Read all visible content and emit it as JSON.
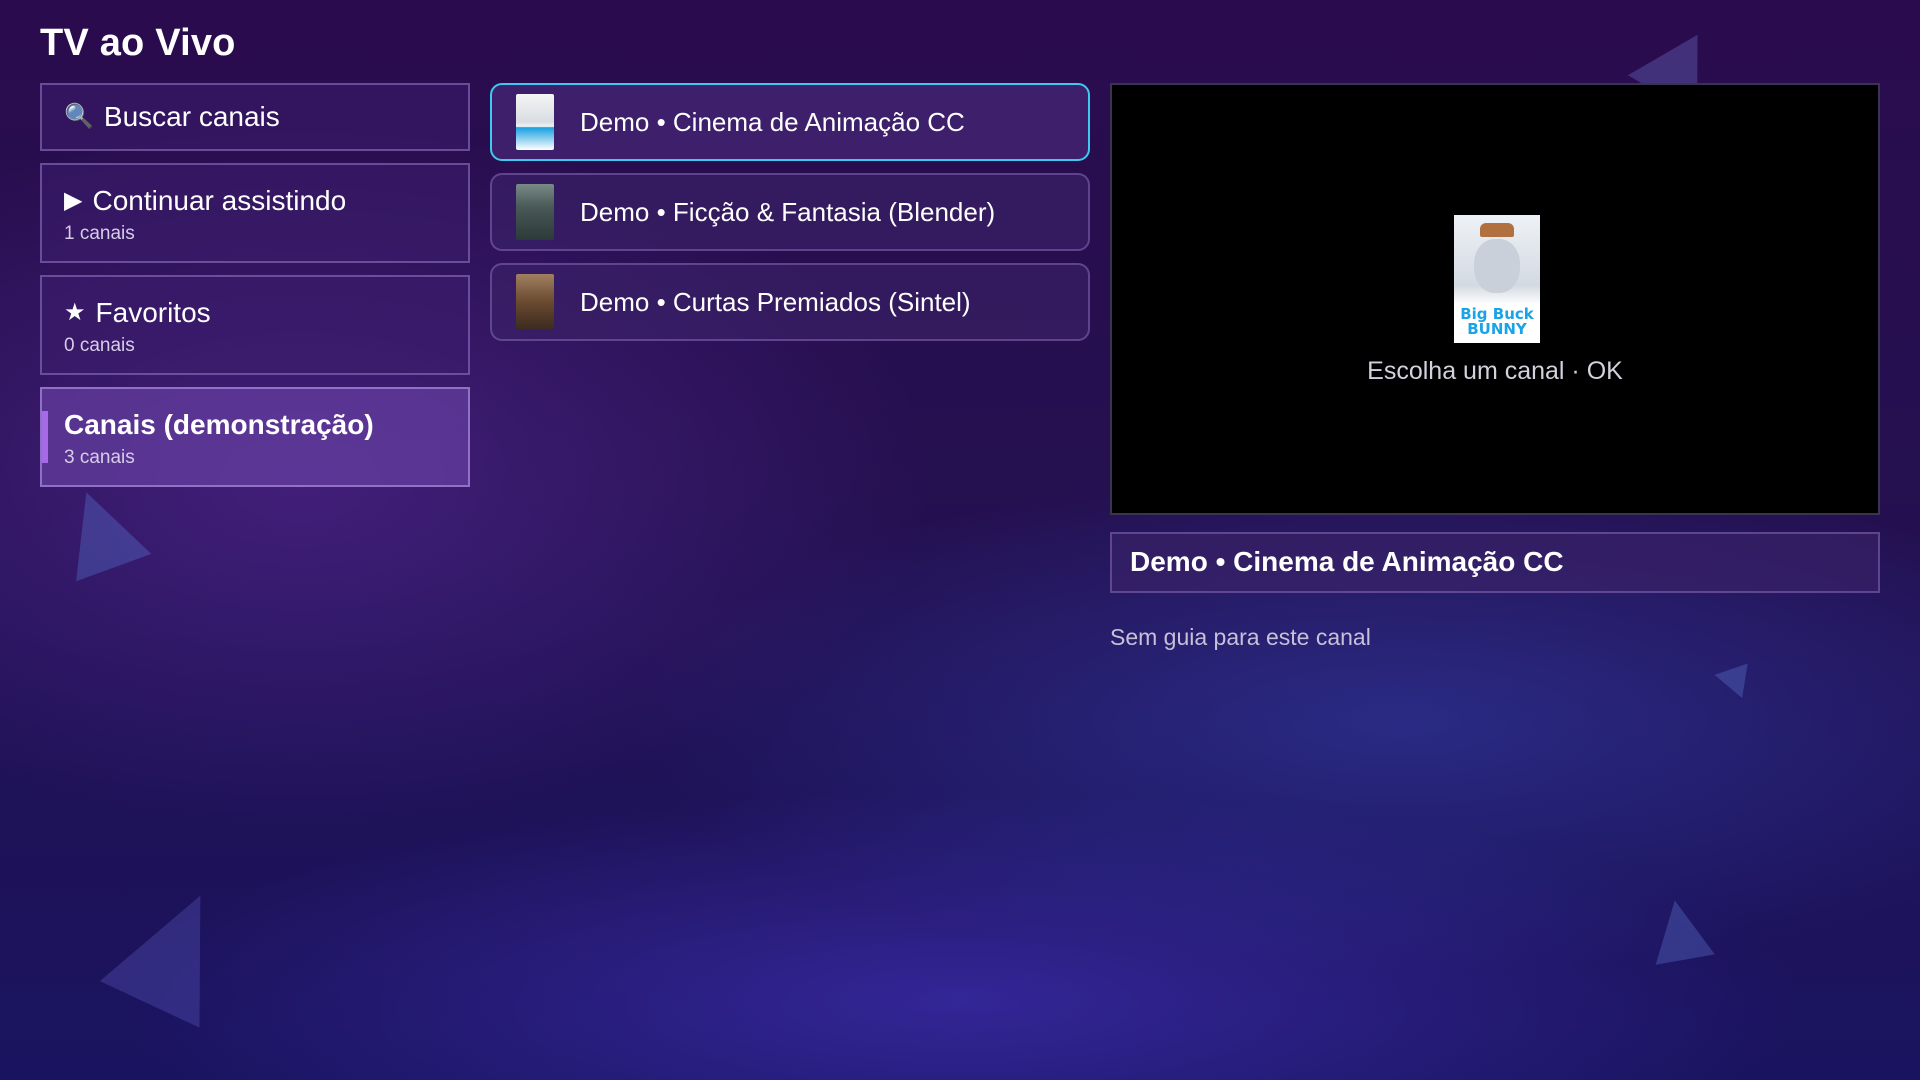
{
  "page": {
    "title": "TV ao Vivo"
  },
  "menu": {
    "search_label": "Buscar canais",
    "items": [
      {
        "label": "Continuar assistindo",
        "count": "1 canais",
        "icon": "play-icon"
      },
      {
        "label": "Favoritos",
        "count": "0 canais",
        "icon": "star-icon"
      },
      {
        "label": "Canais (demonstração)",
        "count": "3 canais",
        "active": true
      }
    ]
  },
  "channels": [
    {
      "name": "Demo • Cinema de Animação CC",
      "selected": true
    },
    {
      "name": "Demo • Ficção & Fantasia (Blender)"
    },
    {
      "name": "Demo • Curtas Premiados (Sintel)"
    }
  ],
  "preview": {
    "poster_title": "Big Buck BUNNY",
    "hint": "Escolha um canal · OK"
  },
  "now_playing": {
    "channel": "Demo • Cinema de Animação CC"
  },
  "epg": {
    "note": "Sem guia para este canal"
  },
  "colors": {
    "accent_focus": "#3fc8f0",
    "active_bar": "#a66ae8"
  }
}
